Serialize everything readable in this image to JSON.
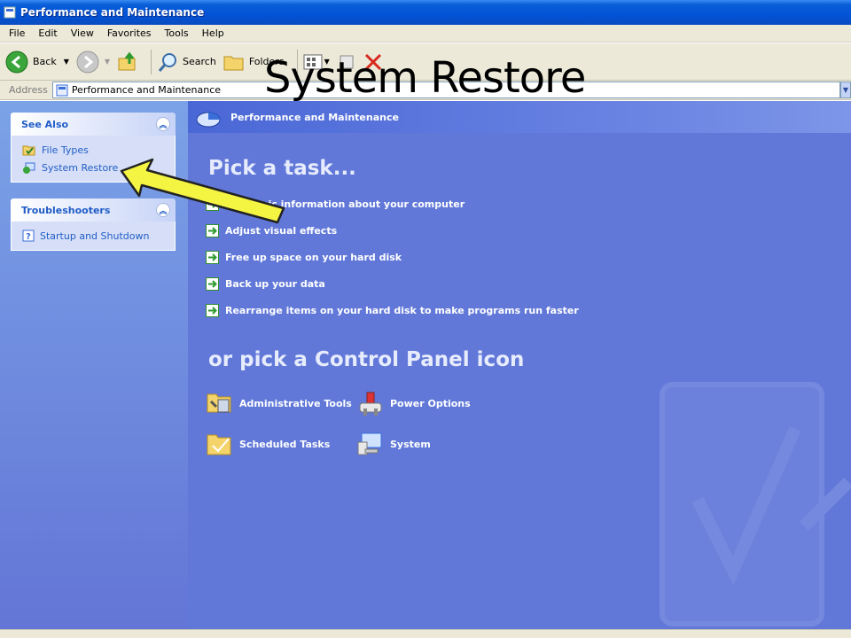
{
  "window": {
    "title": "Performance and Maintenance"
  },
  "menu": [
    "File",
    "Edit",
    "View",
    "Favorites",
    "Tools",
    "Help"
  ],
  "toolbar": {
    "back": "Back",
    "search": "Search",
    "folders": "Folders"
  },
  "address": {
    "label": "Address",
    "value": "Performance and Maintenance"
  },
  "see_also": {
    "title": "See Also",
    "items": [
      {
        "label": "File Types",
        "icon": "file-types-icon"
      },
      {
        "label": "System Restore",
        "icon": "system-restore-icon"
      }
    ]
  },
  "troubleshooters": {
    "title": "Troubleshooters",
    "items": [
      {
        "label": "Startup and Shutdown",
        "icon": "help-icon"
      }
    ]
  },
  "content": {
    "banner": "Performance and Maintenance",
    "pick_task": "Pick a task...",
    "tasks": [
      "See basic information about your computer",
      "Adjust visual effects",
      "Free up space on your hard disk",
      "Back up your data",
      "Rearrange items on your hard disk to make programs run faster"
    ],
    "pick_icon": "or pick a Control Panel icon",
    "icons": [
      {
        "label": "Administrative Tools",
        "icon": "administrative-tools-icon"
      },
      {
        "label": "Power Options",
        "icon": "power-options-icon"
      },
      {
        "label": "Scheduled Tasks",
        "icon": "scheduled-tasks-icon"
      },
      {
        "label": "System",
        "icon": "system-icon"
      }
    ]
  },
  "overlay": {
    "title": "System Restore"
  },
  "colors": {
    "title_bar": "#0253d6",
    "task_pane": "#d6dff7",
    "content_bg": "#6178d8",
    "pointer": "#f4f442"
  }
}
